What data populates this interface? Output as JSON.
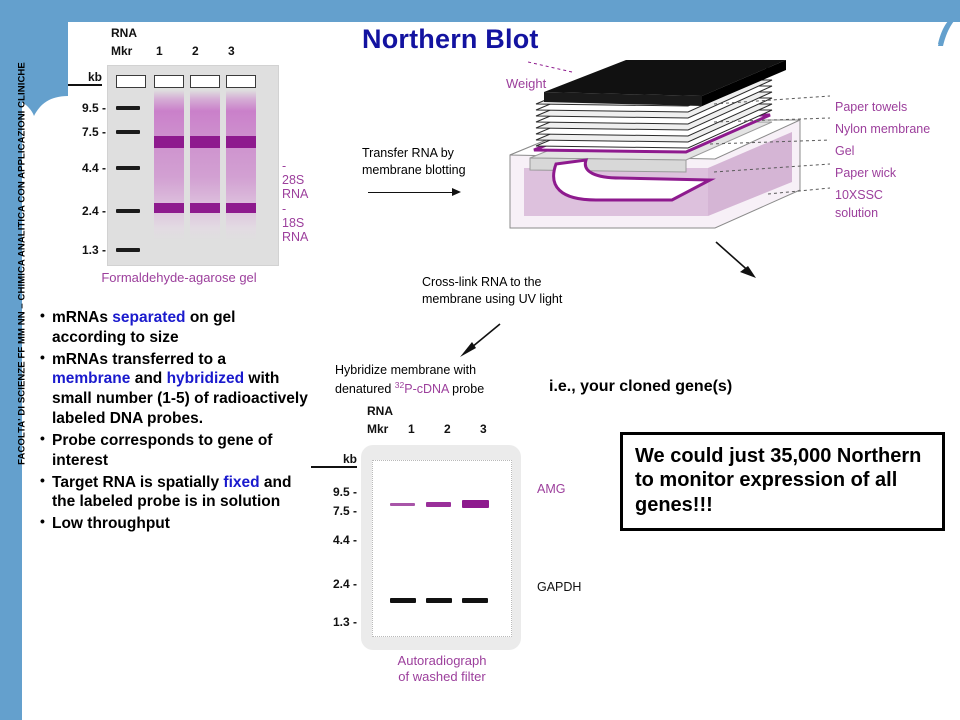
{
  "slide": {
    "title": "Northern Blot",
    "footer_vertical": "FACOLTA' DI SCIENZE FF MM NN – CHIMICA ANALITICA CON APPLICAZIONI CLINICHE",
    "accent_blue": "#64a0cd",
    "title_blue": "#1313a0",
    "highlight_blue": "#1a1acd",
    "band_purple": "#8e1a8e",
    "label_purple": "#9c3f9c"
  },
  "gel_panel": {
    "header_line1": "RNA",
    "header_line2": "Mkr",
    "lane_numbers": [
      "1",
      "2",
      "3"
    ],
    "kb_header": "kb",
    "kb_ticks": [
      "9.5 -",
      "7.5 -",
      "4.4 -",
      "2.4 -",
      "1.3 -"
    ],
    "side_labels": [
      "- 28S RNA",
      "- 18S RNA"
    ],
    "caption": "Formaldehyde-agarose gel"
  },
  "transfer": {
    "line1": "Transfer RNA by",
    "line2": "membrane blotting"
  },
  "blot_diagram": {
    "weight_label": "Weight",
    "leaders": [
      "Paper towels",
      "Nylon membrane",
      "Gel",
      "Paper wick",
      "10XSSC",
      "solution"
    ]
  },
  "steps": {
    "crosslink_line1": "Cross-link RNA to the",
    "crosslink_line2": "membrane using UV light",
    "hybridize_line1": "Hybridize membrane with",
    "hybridize_pre": "denatured ",
    "hybridize_sup": "32",
    "hybridize_mid": "P-cDNA",
    "hybridize_post": " probe"
  },
  "auto_panel": {
    "header_line1": "RNA",
    "header_line2": "Mkr",
    "lane_numbers": [
      "1",
      "2",
      "3"
    ],
    "kb_header": "kb",
    "kb_ticks": [
      "9.5 -",
      "7.5 -",
      "4.4 -",
      "2.4 -",
      "1.3 -"
    ],
    "probe_label": "AMG",
    "control_label": "GAPDH",
    "caption_line1": "Autoradiograph",
    "caption_line2": "of washed filter"
  },
  "bullets": [
    {
      "parts": [
        {
          "t": "mRNAs ",
          "hl": false
        },
        {
          "t": "separated",
          "hl": true
        },
        {
          "t": " on gel according to size",
          "hl": false
        }
      ]
    },
    {
      "parts": [
        {
          "t": "mRNAs transferred to a ",
          "hl": false
        },
        {
          "t": "membrane",
          "hl": true
        },
        {
          "t": " and ",
          "hl": false
        },
        {
          "t": "hybridized",
          "hl": true
        },
        {
          "t": "  with small number (1-5) of radioactively labeled DNA probes.",
          "hl": false
        }
      ]
    },
    {
      "parts": [
        {
          "t": "Probe corresponds to gene of interest",
          "hl": false
        }
      ]
    },
    {
      "parts": [
        {
          "t": "Target RNA is spatially ",
          "hl": false
        },
        {
          "t": "fixed",
          "hl": true
        },
        {
          "t": " and the labeled probe is in solution",
          "hl": false
        }
      ]
    },
    {
      "parts": [
        {
          "t": "Low throughput",
          "hl": false
        }
      ]
    }
  ],
  "notes": {
    "ie_note": "i.e., your cloned gene(s)",
    "callout": "We could just 35,000 Northern to monitor expression of all genes!!!"
  },
  "chart_data": {
    "type": "table",
    "title": "Northern blot gel / autoradiograph band intensities",
    "panels": [
      {
        "name": "Formaldehyde-agarose gel",
        "lanes": [
          "Mkr",
          "1",
          "2",
          "3"
        ],
        "kb_ladder": [
          9.5,
          7.5,
          4.4,
          2.4,
          1.3
        ],
        "bands": [
          {
            "label": "28S RNA",
            "approx_kb": 4.8,
            "lanes": {
              "1": "strong",
              "2": "strong",
              "3": "strong"
            }
          },
          {
            "label": "18S RNA",
            "approx_kb": 2.3,
            "lanes": {
              "1": "strong",
              "2": "strong",
              "3": "strong"
            }
          }
        ]
      },
      {
        "name": "Autoradiograph of washed filter",
        "lanes": [
          "Mkr",
          "1",
          "2",
          "3"
        ],
        "kb_ladder": [
          9.5,
          7.5,
          4.4,
          2.4,
          1.3
        ],
        "bands": [
          {
            "label": "AMG",
            "approx_kb": 8.5,
            "lanes": {
              "1": "weak",
              "2": "medium",
              "3": "strong"
            }
          },
          {
            "label": "GAPDH",
            "approx_kb": 2.2,
            "lanes": {
              "1": "equal",
              "2": "equal",
              "3": "equal"
            }
          }
        ]
      }
    ]
  }
}
